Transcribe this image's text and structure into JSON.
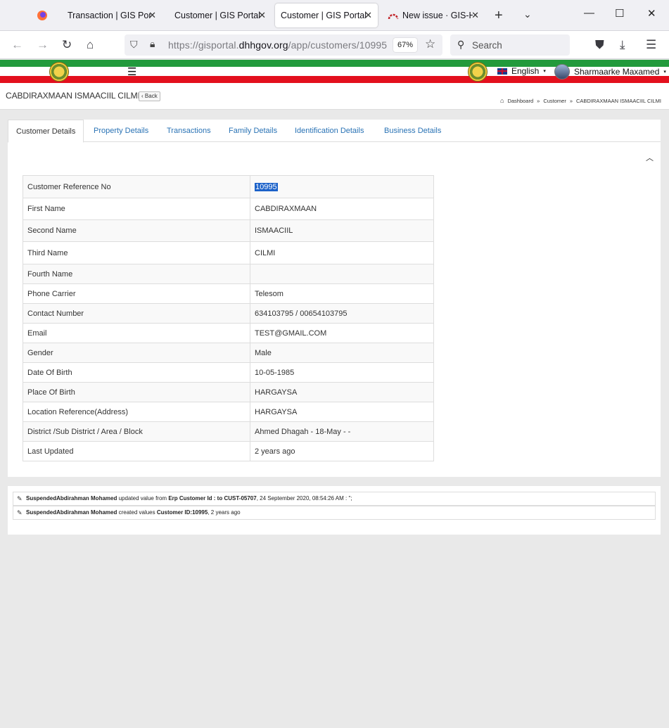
{
  "browser": {
    "tabs": [
      {
        "title": "Transaction | GIS Porta",
        "active": false
      },
      {
        "title": "Customer | GIS Portal",
        "active": false
      },
      {
        "title": "Customer | GIS Portal",
        "active": true
      },
      {
        "title": "New issue · GIS-H",
        "active": false
      }
    ],
    "url_prefix": "https://gisportal.",
    "url_domain": "dhhgov.org",
    "url_path": "/app/customers/10995",
    "zoom": "67%",
    "search_placeholder": "Search"
  },
  "header": {
    "language": "English",
    "user_name": "Sharmaarke Maxamed"
  },
  "page": {
    "title": "CABDIRAXMAAN ISMAACIIL CILMI",
    "back_label": "Back",
    "breadcrumb": [
      "Dashboard",
      "Customer",
      "CABDIRAXMAAN ISMAACIIL CILMI"
    ]
  },
  "tabs": [
    "Customer Details",
    "Property Details",
    "Transactions",
    "Family Details",
    "Identification Details",
    "Business Details"
  ],
  "details": [
    {
      "label": "Customer Reference No",
      "value": "10995"
    },
    {
      "label": "First Name",
      "value": "CABDIRAXMAAN"
    },
    {
      "label": "Second Name",
      "value": "ISMAACIIL"
    },
    {
      "label": "Third Name",
      "value": "CILMI"
    },
    {
      "label": "Fourth Name",
      "value": ""
    },
    {
      "label": "Phone Carrier",
      "value": "Telesom"
    },
    {
      "label": "Contact Number",
      "value": "634103795 / 00654103795"
    },
    {
      "label": "Email",
      "value": "TEST@GMAIL.COM"
    },
    {
      "label": "Gender",
      "value": "Male"
    },
    {
      "label": "Date Of Birth",
      "value": "10-05-1985"
    },
    {
      "label": "Place Of Birth",
      "value": "HARGAYSA"
    },
    {
      "label": "Location Reference(Address)",
      "value": "HARGAYSA"
    },
    {
      "label": "District /Sub District / Area / Block",
      "value": "Ahmed Dhagah - 18-May - -"
    },
    {
      "label": "Last Updated",
      "value": "2 years ago"
    }
  ],
  "log": [
    {
      "user": "SuspendedAbdirahman Mohamed",
      "action": "updated value from",
      "detail": "Erp Customer Id : to CUST-05707",
      "time": ", 24 September 2020, 08:54:26 AM : \";"
    },
    {
      "user": "SuspendedAbdirahman Mohamed",
      "action": "created values",
      "detail": "Customer ID:10995",
      "time": ", 2 years ago"
    }
  ]
}
